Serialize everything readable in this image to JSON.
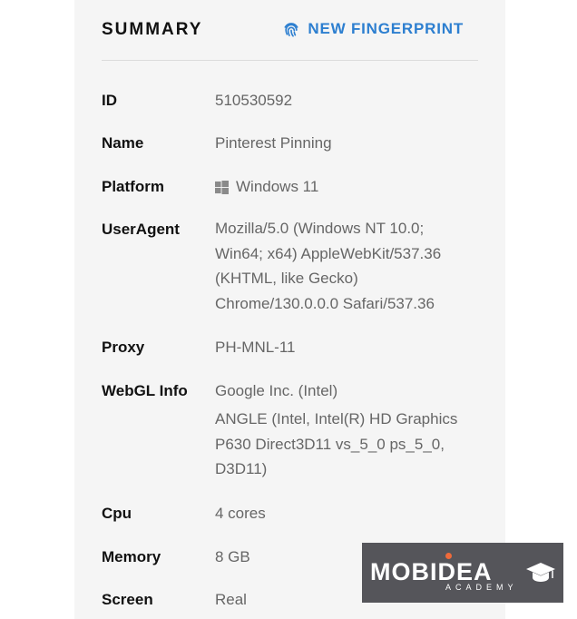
{
  "header": {
    "title": "SUMMARY",
    "new_fingerprint_label": "NEW FINGERPRINT"
  },
  "summary": {
    "id": {
      "label": "ID",
      "value": "510530592"
    },
    "name": {
      "label": "Name",
      "value": "Pinterest Pinning"
    },
    "platform": {
      "label": "Platform",
      "value": "Windows 11",
      "icon": "windows-icon"
    },
    "useragent": {
      "label": "UserAgent",
      "lines": [
        "Mozilla/5.0 (Windows NT 10.0;",
        "Win64; x64) AppleWebKit/537.36",
        "(KHTML, like Gecko)",
        "Chrome/130.0.0.0 Safari/537.36"
      ]
    },
    "proxy": {
      "label": "Proxy",
      "value": "PH-MNL-11"
    },
    "webgl": {
      "label": "WebGL Info",
      "vendor": "Google Inc. (Intel)",
      "renderer_lines": [
        "ANGLE (Intel, Intel(R) HD Graphics",
        "P630 Direct3D11 vs_5_0 ps_5_0,",
        "D3D11)"
      ]
    },
    "cpu": {
      "label": "Cpu",
      "value": "4 cores"
    },
    "memory": {
      "label": "Memory",
      "value": "8 GB"
    },
    "screen": {
      "label": "Screen",
      "value": "Real"
    }
  },
  "watermark": {
    "brand": "MOBIDEA",
    "sub": "ACADEMY"
  },
  "colors": {
    "accent": "#2d7fd0",
    "panel_bg": "#f5f5f5",
    "label": "#111111",
    "value": "#666666",
    "logo_bg": "#55555a",
    "logo_dot": "#ef6a3a"
  }
}
